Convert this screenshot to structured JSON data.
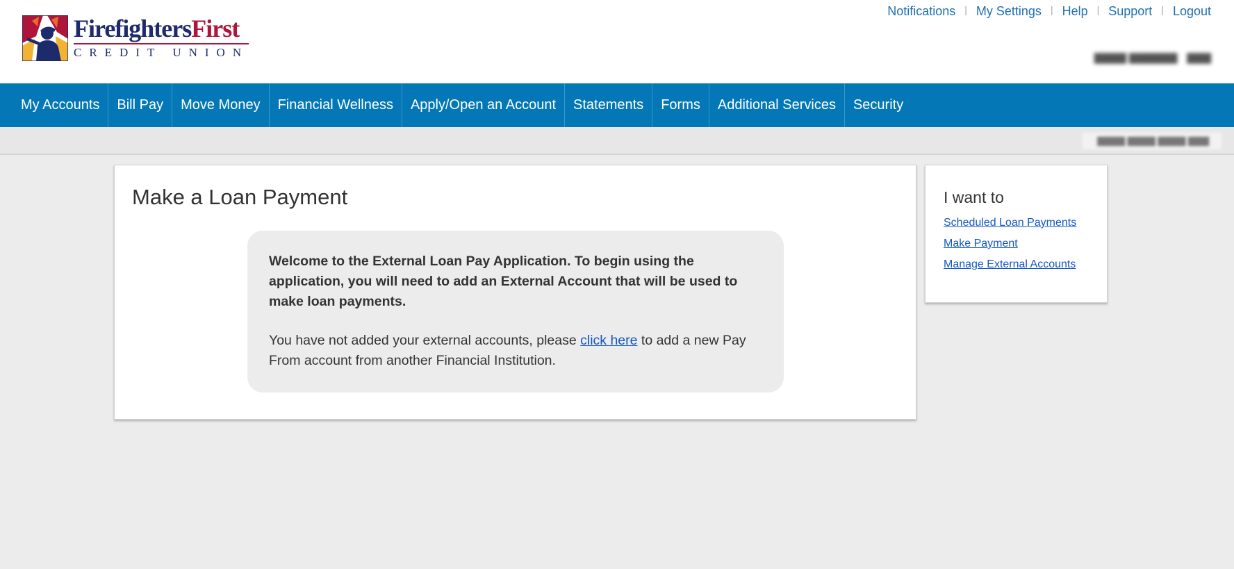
{
  "brand": {
    "word1": "Firefighters",
    "word2": "First",
    "subtitle": "CREDIT UNION",
    "logo_icon": "firefighter-logo-icon",
    "colors": {
      "navy": "#1d2a6b",
      "red": "#b0143a",
      "nav_blue": "#0477b7",
      "link_blue": "#1557c0"
    }
  },
  "top_links": [
    {
      "label": "Notifications"
    },
    {
      "label": "My Settings"
    },
    {
      "label": "Help"
    },
    {
      "label": "Support"
    },
    {
      "label": "Logout"
    }
  ],
  "nav": {
    "items": [
      {
        "label": "My Accounts"
      },
      {
        "label": "Bill Pay"
      },
      {
        "label": "Move Money"
      },
      {
        "label": "Financial Wellness"
      },
      {
        "label": "Apply/Open an Account"
      },
      {
        "label": "Statements"
      },
      {
        "label": "Forms"
      },
      {
        "label": "Additional Services"
      },
      {
        "label": "Security"
      }
    ]
  },
  "main": {
    "title": "Make a Loan Payment",
    "welcome_text": "Welcome to the External Loan Pay Application. To begin using the application, you will need to add an External Account that will be used to make loan payments.",
    "info_prefix": "You have not added your external accounts, please ",
    "info_link": "click here",
    "info_suffix": " to add a new Pay From account from another Financial Institution."
  },
  "side": {
    "title": "I want to",
    "links": [
      {
        "label": "Scheduled Loan Payments"
      },
      {
        "label": "Make Payment"
      },
      {
        "label": "Manage External Accounts"
      }
    ]
  }
}
